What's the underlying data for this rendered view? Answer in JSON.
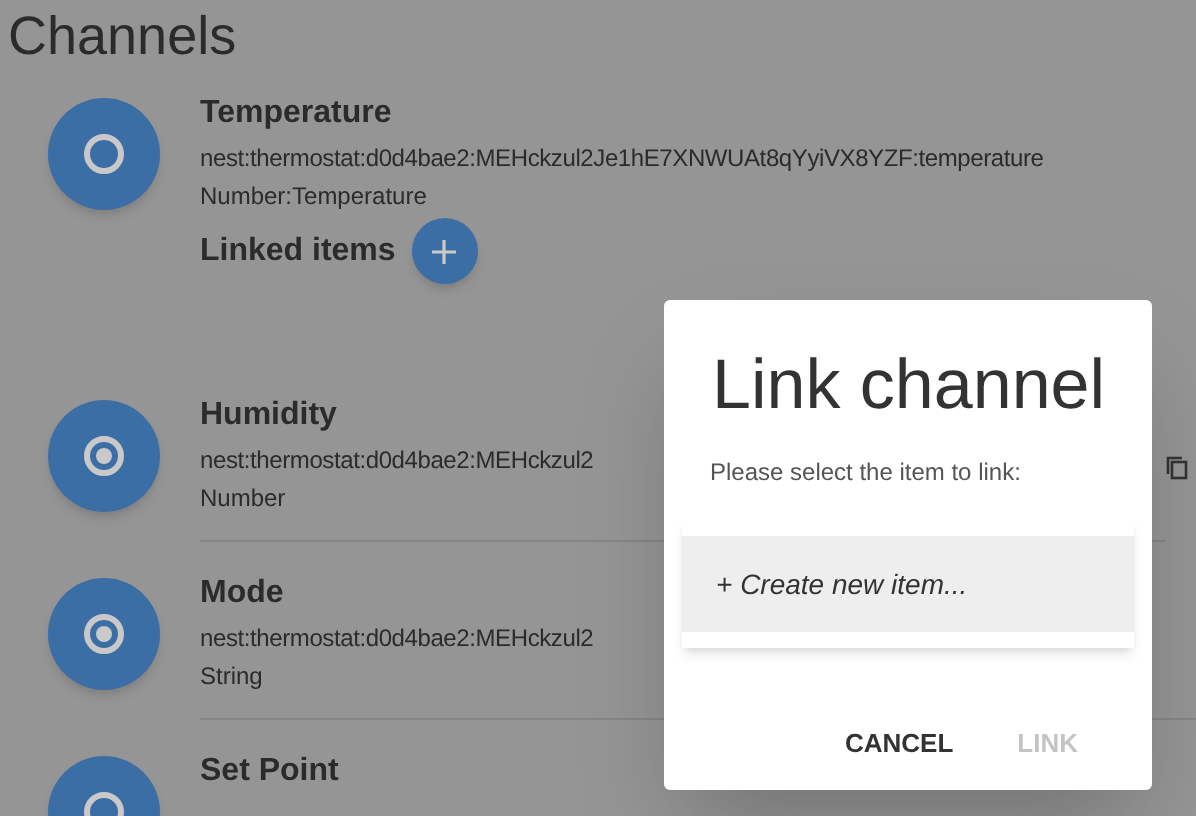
{
  "page": {
    "title": "Channels"
  },
  "channels": [
    {
      "name": "Temperature",
      "uid": "nest:thermostat:d0d4bae2:MEHckzul2Je1hE7XNWUAt8qYyiVX8YZF:temperature",
      "type": "Number:Temperature",
      "linked": false,
      "linked_items_label": "Linked items",
      "copy_icon": false
    },
    {
      "name": "Humidity",
      "uid": "nest:thermostat:d0d4bae2:MEHckzul2",
      "type": "Number",
      "linked": true,
      "copy_icon": true
    },
    {
      "name": "Mode",
      "uid": "nest:thermostat:d0d4bae2:MEHckzul2",
      "type": "String",
      "linked": true,
      "copy_icon": false
    },
    {
      "name": "Set Point",
      "linked": false,
      "copy_icon": false
    }
  ],
  "dialog": {
    "title": "Link channel",
    "prompt": "Please select the item to link:",
    "options": [
      {
        "label": "+ Create new item...",
        "selected": true
      }
    ],
    "buttons": [
      {
        "label": "CANCEL",
        "disabled": false
      },
      {
        "label": "LINK",
        "disabled": true
      }
    ]
  }
}
